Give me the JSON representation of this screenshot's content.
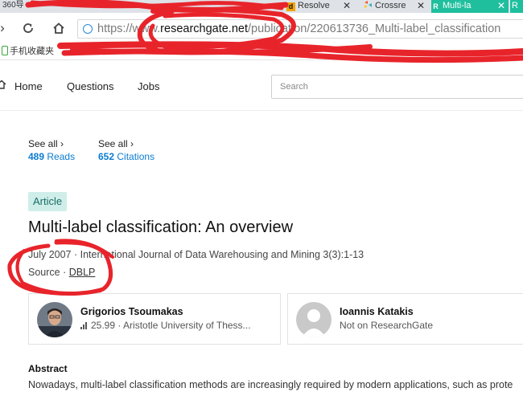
{
  "browser": {
    "tabs": [
      {
        "label": "360导",
        "icon": "browser-logo-icon"
      },
      {
        "label": "Resolve",
        "icon": "d-favicon-icon",
        "favicon_letter": "d",
        "favicon_bg": "#f0a400"
      },
      {
        "label": "Crossre",
        "icon": "crossref-favicon-icon"
      },
      {
        "label": "Multi-la",
        "icon": "rg-favicon-icon",
        "favicon_letter": "R",
        "active": true
      },
      {
        "label": "R",
        "icon": "rg-favicon-icon"
      }
    ],
    "url": {
      "scheme": "https://www.",
      "host": "researchgate.net",
      "path": "/publication/220613736_Multi-label_classification"
    },
    "bookmarks": [
      {
        "label": "手机收藏夹",
        "icon": "phone-icon"
      }
    ]
  },
  "site": {
    "nav": {
      "home": "Home",
      "questions": "Questions",
      "jobs": "Jobs",
      "search_placeholder": "Search"
    }
  },
  "stats": [
    {
      "see_all": "See all ›",
      "count": "489",
      "label": "Reads"
    },
    {
      "see_all": "See all ›",
      "count": "652",
      "label": "Citations"
    }
  ],
  "article": {
    "badge": "Article",
    "title": "Multi-label classification: An overview",
    "meta": "July 2007 · International Journal of Data Warehousing and Mining 3(3):1-13",
    "source_prefix": "Source · ",
    "source_link": "DBLP"
  },
  "authors": [
    {
      "name": "Grigorios Tsoumakas",
      "score": "25.99",
      "affiliation": "· Aristotle University of Thess...",
      "avatar": "photo"
    },
    {
      "name": "Ioannis Katakis",
      "note": "Not on ResearchGate",
      "avatar": "placeholder"
    }
  ],
  "abstract": {
    "heading": "Abstract",
    "text": "Nowadays, multi-label classification methods are increasingly required by modern applications, such as prote"
  },
  "colors": {
    "accent_blue": "#0b7bd1",
    "badge_bg": "#cfeee9",
    "badge_text": "#1a6e66",
    "annotation_red": "#e8242b"
  }
}
